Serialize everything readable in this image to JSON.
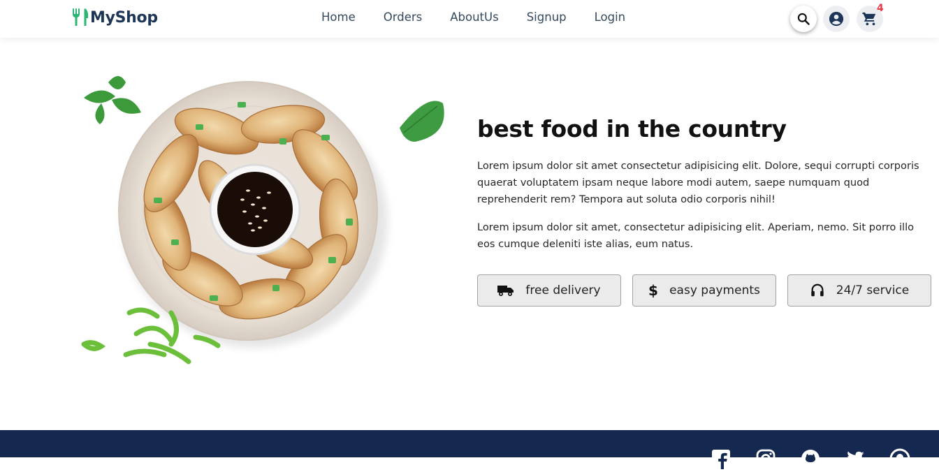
{
  "header": {
    "brand": "MyShop",
    "nav": [
      "Home",
      "Orders",
      "AboutUs",
      "Signup",
      "Login"
    ],
    "cart_count": "4",
    "icons": [
      "search-icon",
      "account-icon",
      "cart-icon"
    ]
  },
  "hero": {
    "title": "best food in the country",
    "paragraph1": "Lorem ipsum dolor sit amet consectetur adipisicing elit. Dolore, sequi corrupti corporis quaerat voluptatem ipsam neque labore modi autem, saepe numquam quod reprehenderit rem? Tempora aut soluta odio corporis nihil!",
    "paragraph2": "Lorem ipsum dolor sit amet, consectetur adipisicing elit. Aperiam, nemo. Sit porro illo eos cumque deleniti iste alias, eum natus.",
    "features": [
      {
        "label": "free delivery",
        "icon": "truck-icon"
      },
      {
        "label": "easy payments",
        "icon": "dollar-icon"
      },
      {
        "label": "24/7 service",
        "icon": "headset-icon"
      }
    ]
  },
  "footer": {
    "social_icons": [
      "facebook-icon",
      "instagram-icon",
      "github-icon",
      "twitter-icon",
      "pinterest-icon"
    ]
  },
  "colors": {
    "brand_navy": "#1d3557",
    "logo_green": "#2bb673",
    "badge_red": "#e63946",
    "footer_bg": "#142850"
  }
}
